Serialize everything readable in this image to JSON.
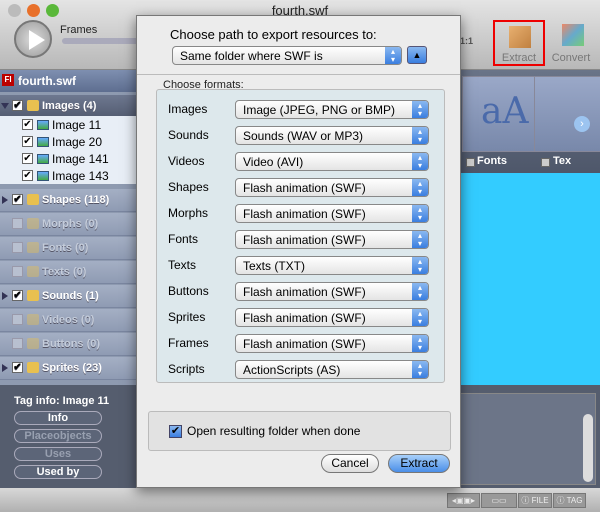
{
  "window": {
    "title": "fourth.swf"
  },
  "toolbar": {
    "frames_label": "Frames",
    "zoom_label": "1:1",
    "extract_label": "Extract",
    "convert_label": "Convert"
  },
  "sidebar": {
    "file": "fourth.swf",
    "groups": [
      {
        "label": "Images (4)",
        "checked": true,
        "enabled": true,
        "expanded": true,
        "children": [
          "Image 11",
          "Image 20",
          "Image 141",
          "Image 143"
        ]
      },
      {
        "label": "Shapes (118)",
        "checked": true,
        "enabled": true
      },
      {
        "label": "Morphs (0)",
        "checked": false,
        "enabled": false
      },
      {
        "label": "Fonts (0)",
        "checked": false,
        "enabled": false
      },
      {
        "label": "Texts (0)",
        "checked": false,
        "enabled": false
      },
      {
        "label": "Sounds (1)",
        "checked": true,
        "enabled": true
      },
      {
        "label": "Videos (0)",
        "checked": false,
        "enabled": false
      },
      {
        "label": "Buttons (0)",
        "checked": false,
        "enabled": false
      },
      {
        "label": "Sprites (23)",
        "checked": true,
        "enabled": true
      }
    ]
  },
  "thumbs": [
    "Fonts",
    "Tex"
  ],
  "taginfo": {
    "title": "Tag info: Image 11",
    "buttons": [
      {
        "label": "Info",
        "enabled": true
      },
      {
        "label": "Placeobjects",
        "enabled": false
      },
      {
        "label": "Uses",
        "enabled": false
      },
      {
        "label": "Used by",
        "enabled": true
      }
    ]
  },
  "statusbar": {
    "file": "FILE",
    "tag": "TAG"
  },
  "dialog": {
    "path_prompt": "Choose path to export resources to:",
    "path_value": "Same folder where SWF is",
    "formats_label": "Choose formats:",
    "formats": [
      {
        "label": "Images",
        "value": "Image (JPEG, PNG or BMP)"
      },
      {
        "label": "Sounds",
        "value": "Sounds (WAV or MP3)"
      },
      {
        "label": "Videos",
        "value": "Video (AVI)"
      },
      {
        "label": "Shapes",
        "value": "Flash animation (SWF)"
      },
      {
        "label": "Morphs",
        "value": "Flash animation (SWF)"
      },
      {
        "label": "Fonts",
        "value": "Flash animation (SWF)"
      },
      {
        "label": "Texts",
        "value": "Texts (TXT)"
      },
      {
        "label": "Buttons",
        "value": "Flash animation (SWF)"
      },
      {
        "label": "Sprites",
        "value": "Flash animation (SWF)"
      },
      {
        "label": "Frames",
        "value": "Flash animation (SWF)"
      },
      {
        "label": "Scripts",
        "value": "ActionScripts (AS)"
      }
    ],
    "open_folder_label": "Open resulting folder when done",
    "open_folder_checked": true,
    "cancel_label": "Cancel",
    "extract_label": "Extract"
  },
  "colors": {
    "canvas": "#33ccff",
    "accent": "#3a7ee0",
    "highlight_box": "#ee0000"
  }
}
